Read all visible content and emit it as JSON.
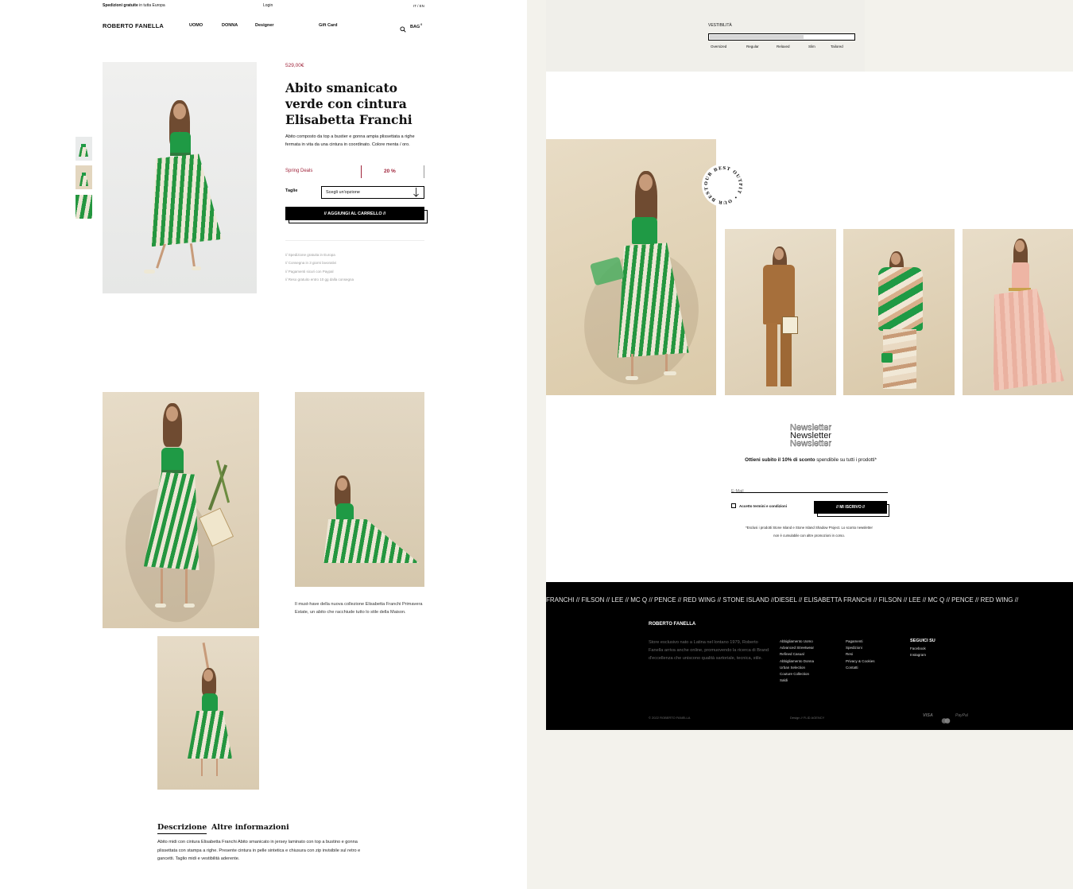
{
  "topbar": {
    "shipping_bold": "Spedizioni gratuite",
    "shipping_rest": " in tutta Europa",
    "login": "Login",
    "lang": "IT / EN"
  },
  "header": {
    "logo": "ROBERTO FANELLA",
    "nav": [
      "UOMO",
      "DONNA",
      "Designer"
    ],
    "gift_card": "Gift Card",
    "bag": "BAG",
    "bag_count": "0"
  },
  "product": {
    "price": "529,00€",
    "title_lines": [
      "Abito smanicato",
      "verde con cintura",
      "Elisabetta Franchi"
    ],
    "description": "Abito composto da top a bustier e gonna ampia plissettata a righe fermata in vita da una cintura in coordinato. Colore menta / oro.",
    "promo_label": "Spring Deals",
    "promo_value": "20 %",
    "size_label": "Taglie",
    "size_placeholder": "Scegli un'opzione",
    "add_to_cart": "// AGGIUNGI AL CARRELLO //",
    "perks": [
      "// Spedizione gratuita in Europa",
      "// Consegna in 3 giorni lavorativi",
      "// Pagamenti sicuri con Paypal",
      "// Reso gratuito entro 10 gg dalla consegna"
    ]
  },
  "editorial": {
    "caption": "Il must-have della nuova collezione Elisabetta Franchi Primavera Estate, un abito che racchiude tutto lo stile della Maison."
  },
  "tabs": {
    "items": [
      "Descrizione",
      "Altre informazioni"
    ],
    "active": "Descrizione",
    "description_text": "Abito midi con cintura Elisabetta Franchi Abito smanicato in jersey laminato con top a bustino e gonna plissettata con stampa a righe. Presente cintura in pelle sintetica e chiusura con zip invisibile sul retro e gancetti. Taglio midi e vestibilità aderente."
  },
  "fit": {
    "label": "VESTIBILITÀ",
    "options": [
      "Oversized",
      "Regular",
      "Relaxed",
      "Slim",
      "Tailored"
    ],
    "level": 0.65
  },
  "outfit": {
    "badge": "OUR BEST OUTFIT • OUR BEST OUTFIT •"
  },
  "newsletter": {
    "title": "Newsletter",
    "offer_bold": "Ottieni subito il 10% di sconto",
    "offer_rest": " spendibile su tutti i prodotti*",
    "email_placeholder": "E-Mail",
    "terms": "Accetto termini e condizioni",
    "subscribe": "// MI ISCRIVO //",
    "disclaimer_1": "*Esclusi i prodotti Stone Island e Stone Island Shadow Project. Lo sconto newsletter",
    "disclaimer_2": "non è cumulabile con altre promozioni in corso."
  },
  "footer": {
    "marquee": "FRANCHI // FILSON // LEE // MC Q // PENCE // RED WING // STONE ISLAND //DIESEL // ELISABETTA FRANCHI // FILSON // LEE // MC Q // PENCE // RED WING //",
    "logo": "ROBERTO FANELLA",
    "about": "Store esclusivo nato a Latina nel lontano 1979, Roberto Fanella arriva anche online, promuovendo la ricerca di Brand d'eccellenza che uniscono qualità sartoriale, tecnica, stile.",
    "col1": [
      "Abbigliamento Uomo",
      "Advanced Streetwear",
      "Refined Casual",
      "Abbigliamento Donna",
      "Urban Selection",
      "Couture Collection",
      "Saldi"
    ],
    "col2": [
      "Pagamenti",
      "Spedizioni",
      "Resi",
      "Privacy & Cookies",
      "Contatti"
    ],
    "social_title": "SEGUICI SU",
    "social": [
      "Facebook",
      "Instagram"
    ],
    "copyright": "© 2022 ROBERTO FANELLA",
    "credit": "Design // FLID AGENCY",
    "visa": "VISA",
    "paypal": "PayPal"
  },
  "colors": {
    "accent_red": "#a0243b",
    "dress_green": "#1f9a45",
    "photo_beige": "#e3d6bf"
  }
}
